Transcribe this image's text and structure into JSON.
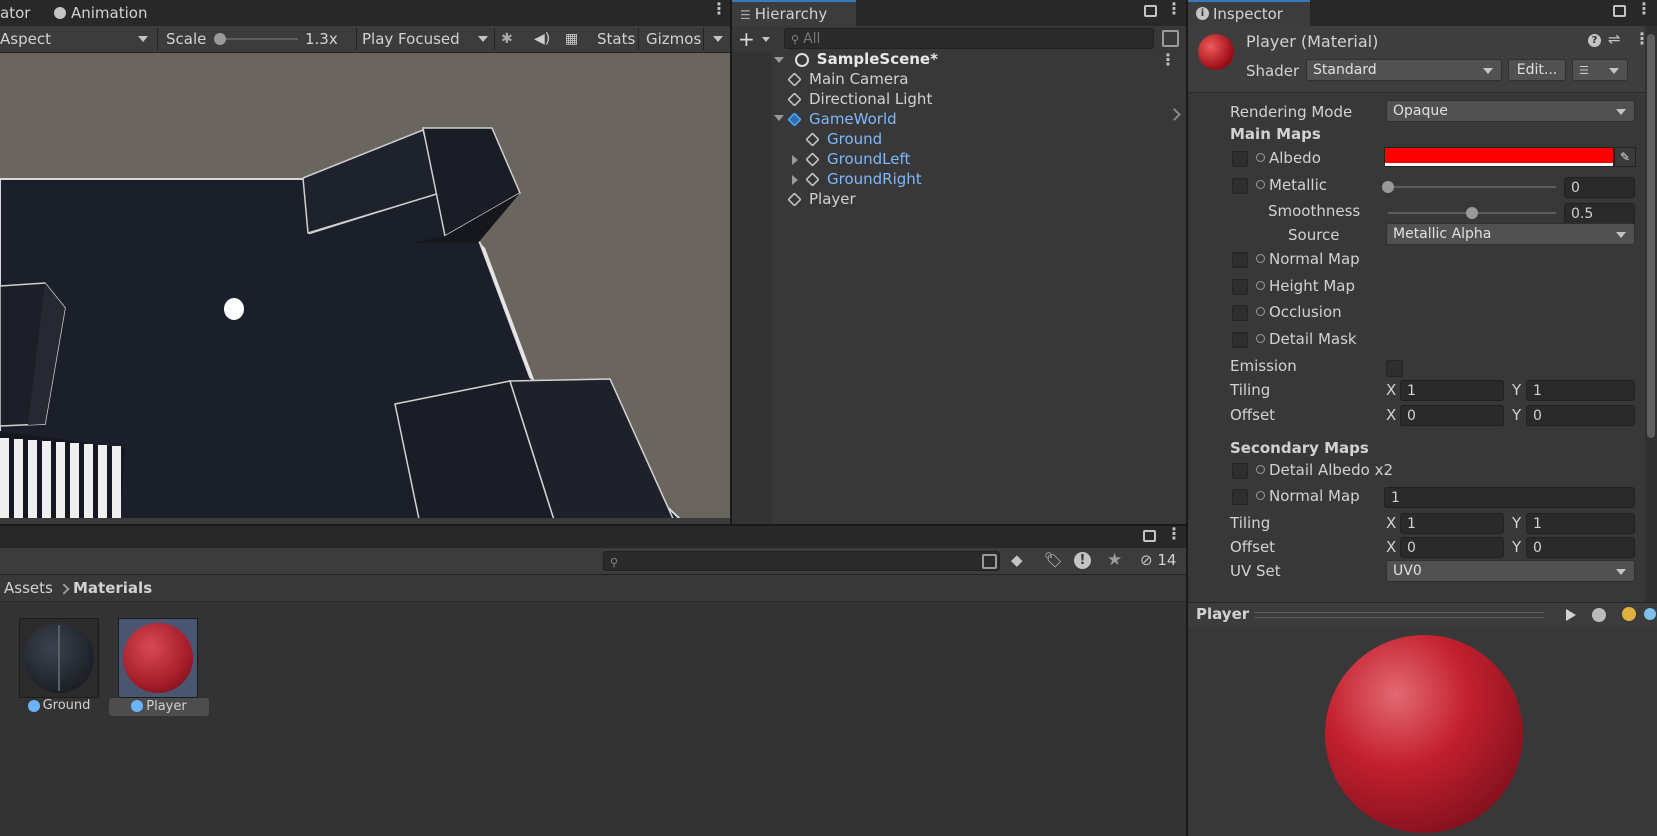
{
  "game_view": {
    "tabs": [
      {
        "label": "ator"
      },
      {
        "label": "Animation"
      }
    ],
    "aspect": "Aspect",
    "scale_label": "Scale",
    "scale_value": "1.3x",
    "scale_fraction": 0.0,
    "play_mode": "Play Focused",
    "stats": "Stats",
    "gizmos": "Gizmos",
    "colors": {
      "background": "#6b6560",
      "floor": "#1b1f29"
    }
  },
  "hierarchy": {
    "tab": "Hierarchy",
    "search_placeholder": "All",
    "scene": "SampleScene*",
    "items": [
      {
        "label": "Main Camera",
        "depth": 1,
        "prefab": false,
        "expand": "none"
      },
      {
        "label": "Directional Light",
        "depth": 1,
        "prefab": false,
        "expand": "none"
      },
      {
        "label": "GameWorld",
        "depth": 1,
        "prefab": true,
        "expand": "open"
      },
      {
        "label": "Ground",
        "depth": 2,
        "prefab": true,
        "expand": "none"
      },
      {
        "label": "GroundLeft",
        "depth": 2,
        "prefab": true,
        "expand": "closed"
      },
      {
        "label": "GroundRight",
        "depth": 2,
        "prefab": true,
        "expand": "closed"
      },
      {
        "label": "Player",
        "depth": 1,
        "prefab": false,
        "expand": "none"
      }
    ]
  },
  "inspector": {
    "tab": "Inspector",
    "title": "Player (Material)",
    "shader_label": "Shader",
    "shader_value": "Standard",
    "edit_button": "Edit...",
    "rendering_mode_label": "Rendering Mode",
    "rendering_mode_value": "Opaque",
    "main_maps_header": "Main Maps",
    "albedo_label": "Albedo",
    "albedo_color": "#ff0000",
    "metallic_label": "Metallic",
    "metallic_value": "0",
    "smoothness_label": "Smoothness",
    "smoothness_value": "0.5",
    "source_label": "Source",
    "source_value": "Metallic Alpha",
    "normal_map_label": "Normal Map",
    "height_map_label": "Height Map",
    "occlusion_label": "Occlusion",
    "detail_mask_label": "Detail Mask",
    "emission_label": "Emission",
    "tiling_label": "Tiling",
    "offset_label": "Offset",
    "x_label": "X",
    "y_label": "Y",
    "main_tiling": [
      "1",
      "1"
    ],
    "main_offset": [
      "0",
      "0"
    ],
    "secondary_maps_header": "Secondary Maps",
    "detail_albedo_label": "Detail Albedo x2",
    "sec_normal_map_label": "Normal Map",
    "sec_normal_value": "1",
    "sec_tiling": [
      "1",
      "1"
    ],
    "sec_offset": [
      "0",
      "0"
    ],
    "uv_set_label": "UV Set",
    "uv_set_value": "UV0",
    "preview_title": "Player",
    "sphere_color": "#c4202e"
  },
  "project": {
    "breadcrumb_root": "Assets",
    "breadcrumb_current": "Materials",
    "hidden_count": "14",
    "assets": [
      {
        "label": "Ground",
        "kind": "dark",
        "selected": false
      },
      {
        "label": "Player",
        "kind": "red",
        "selected": true
      }
    ]
  }
}
